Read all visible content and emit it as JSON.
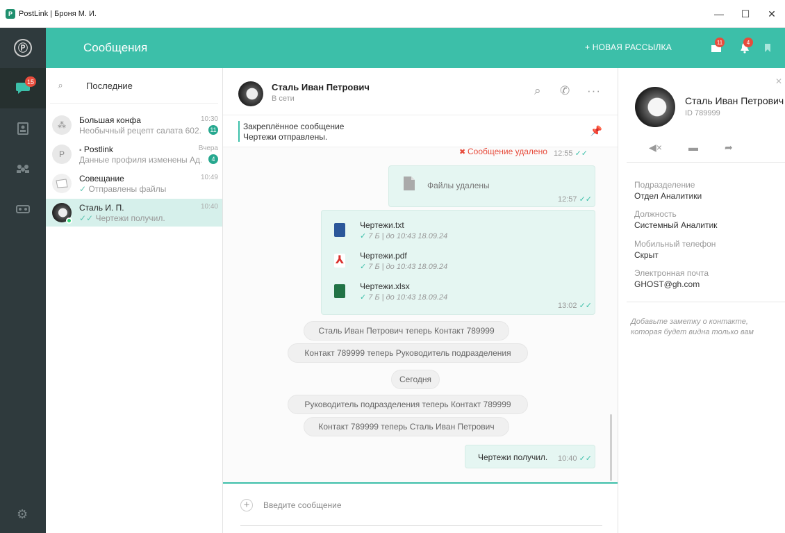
{
  "window": {
    "title": "PostLink  |  Броня М. И.",
    "buttons": {
      "minimize": "—",
      "maximize": "☐",
      "close": "✕"
    }
  },
  "rail": {
    "items": [
      {
        "icon": "chat-icon",
        "badge": "15",
        "active": true
      },
      {
        "icon": "contacts-icon"
      },
      {
        "icon": "groups-icon"
      },
      {
        "icon": "voicemail-icon"
      }
    ],
    "settings_icon": "gear-icon"
  },
  "header": {
    "title": "Сообщения",
    "new_mailing": "+ НОВАЯ РАССЫЛКА",
    "mail_badge": "11",
    "notifications_badge": "4"
  },
  "chat_list": {
    "search_label": "Последние",
    "items": [
      {
        "name": "Большая конфа",
        "time": "10:30",
        "preview": "Необычный рецепт салата 602...",
        "unread": "11",
        "avatar": "group"
      },
      {
        "name": "Postlink",
        "time": "Вчера",
        "preview": "Данные профиля изменены Ад...",
        "unread": "4",
        "avatar_letter": "P"
      },
      {
        "name": "Совещание",
        "time": "10:49",
        "preview_tick": "✓",
        "preview": "Отправлены файлы"
      },
      {
        "name": "Сталь И. П.",
        "time": "10:40",
        "preview_tick": "✓✓",
        "preview": "Чертежи получил.",
        "active": true
      }
    ]
  },
  "conversation": {
    "contact_name": "Сталь Иван Петрович",
    "status": "В сети",
    "pinned_title": "Закреплённое сообщение",
    "pinned_text": "Чертежи отправлены.",
    "messages": {
      "deleted_text": "Сообщение удалено",
      "deleted_time": "12:55",
      "files_deleted_text": "Файлы удалены",
      "files_deleted_time": "12:57",
      "files": [
        {
          "name": "Чертежи.txt",
          "meta": "7 Б  |  до 10:43 18.09.24",
          "color": "#2b579a"
        },
        {
          "name": "Чертежи.pdf",
          "meta": "7 Б  |  до 10:43 18.09.24",
          "color": "#d9302c"
        },
        {
          "name": "Чертежи.xlsx",
          "meta": "7 Б  |  до 10:43 18.09.24",
          "color": "#217346"
        }
      ],
      "files_time": "13:02",
      "system": [
        "Сталь Иван Петрович теперь Контакт 789999",
        "Контакт 789999 теперь Руководитель подразделения",
        "Сегодня",
        "Руководитель подразделения теперь Контакт 789999",
        "Контакт 789999 теперь Сталь Иван Петрович"
      ],
      "last_text": "Чертежи получил.",
      "last_time": "10:40",
      "ticks": "✓✓"
    },
    "composer_placeholder": "Введите сообщение"
  },
  "profile": {
    "name": "Сталь Иван Петрович",
    "id": "ID 789999",
    "fields": [
      {
        "label": "Подразделение",
        "value": "Отдел Аналитики"
      },
      {
        "label": "Должность",
        "value": "Системный Аналитик"
      },
      {
        "label": "Мобильный телефон",
        "value": "Скрыт"
      },
      {
        "label": "Электронная почта",
        "value": "GHOST@gh.com"
      }
    ],
    "note": "Добавьте заметку о контакте, которая будет видна только вам"
  },
  "colors": {
    "accent": "#3cbfa9",
    "rail": "#2f3a3d",
    "badge": "#e74c3c",
    "bubble": "#e5f6f2"
  }
}
